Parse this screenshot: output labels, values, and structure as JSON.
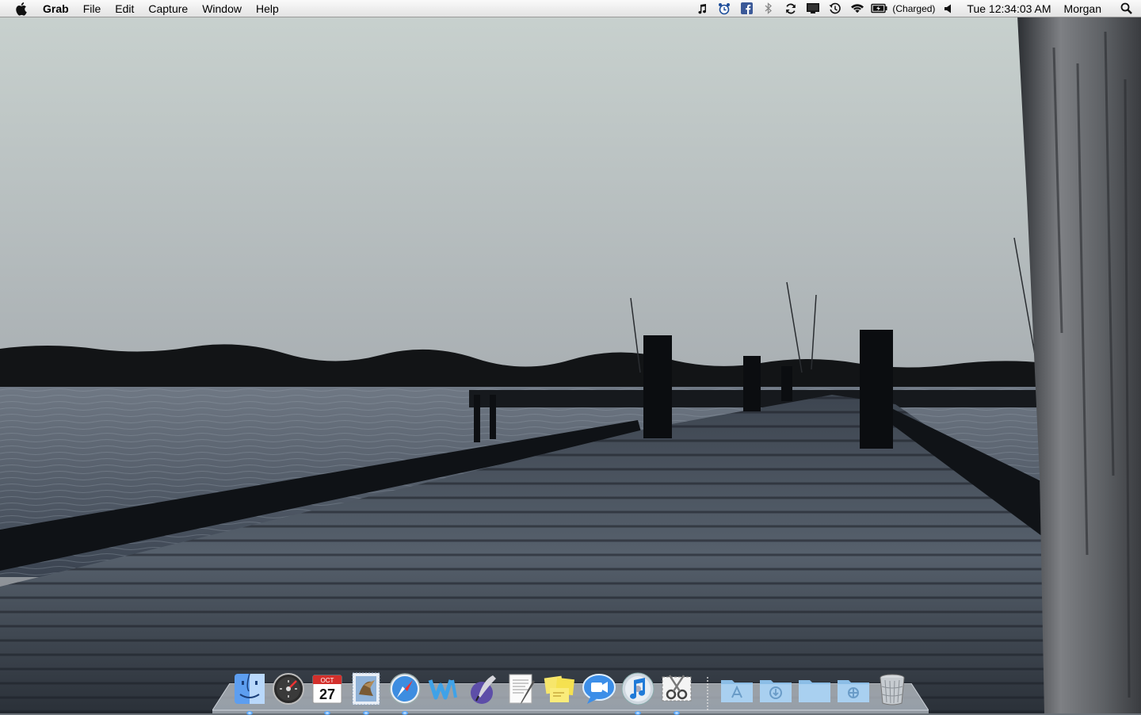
{
  "menubar": {
    "app_name": "Grab",
    "menus": [
      "File",
      "Edit",
      "Capture",
      "Window",
      "Help"
    ],
    "battery_status": "(Charged)",
    "clock": "Tue 12:34:03 AM",
    "user": "Morgan",
    "status_icons": [
      "itunes-note-icon",
      "alarm-clock-icon",
      "facebook-icon",
      "bluetooth-icon",
      "sync-icon",
      "display-icon",
      "time-machine-icon",
      "wifi-icon",
      "battery-icon",
      "volume-icon"
    ]
  },
  "dock": {
    "apps": [
      {
        "name": "finder",
        "running": true
      },
      {
        "name": "dashboard",
        "running": false
      },
      {
        "name": "ical",
        "running": true,
        "calendar_month": "OCT",
        "calendar_day": "27"
      },
      {
        "name": "mail",
        "running": true
      },
      {
        "name": "safari",
        "running": true
      },
      {
        "name": "wunderlist",
        "running": false
      },
      {
        "name": "ipublish",
        "running": false
      },
      {
        "name": "textedit",
        "running": false
      },
      {
        "name": "stickies",
        "running": false
      },
      {
        "name": "ichat",
        "running": false
      },
      {
        "name": "itunes",
        "running": true
      },
      {
        "name": "grab",
        "running": true
      }
    ],
    "stacks": [
      "applications-folder",
      "downloads-folder",
      "documents-folder",
      "utilities-folder"
    ],
    "trash": "trash"
  },
  "colors": {
    "menubar": "#ececec",
    "sky": "#b9bfbf",
    "water": "#4e5a66",
    "dock_dot": "#4aa0ff"
  }
}
